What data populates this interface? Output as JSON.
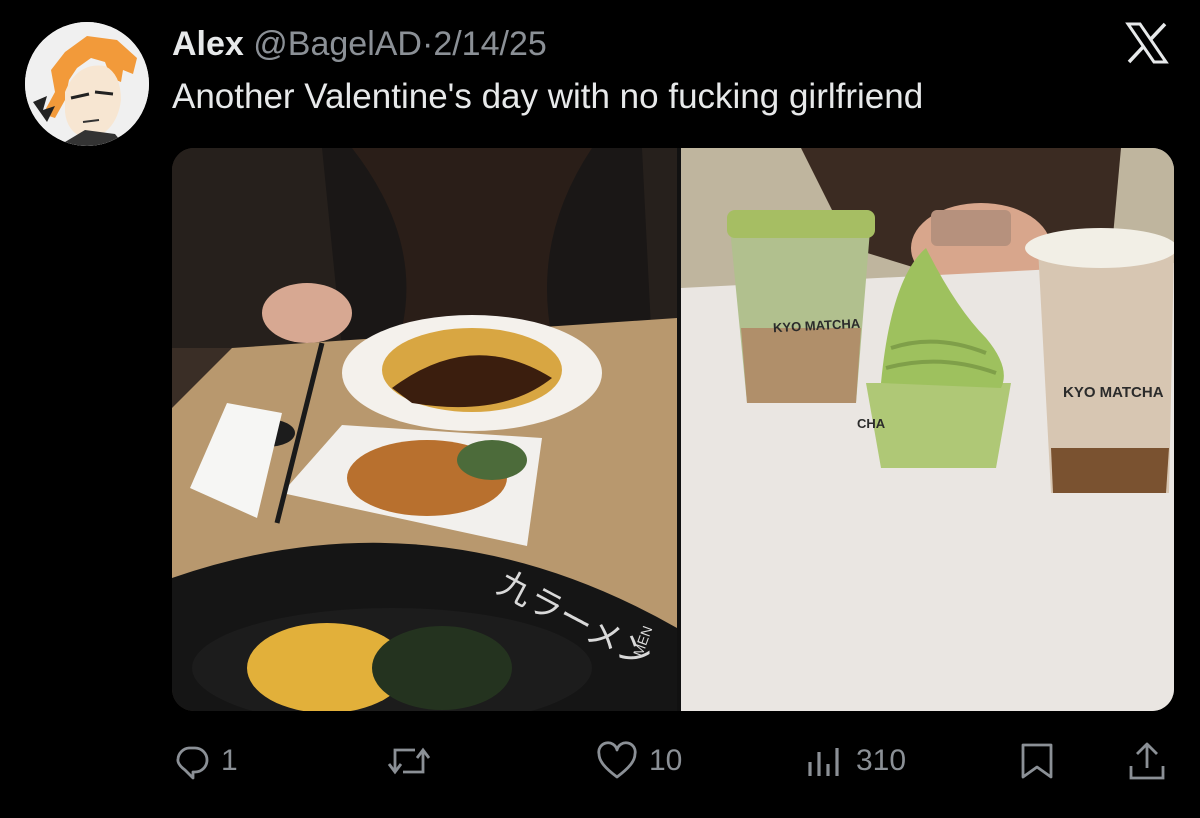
{
  "tweet": {
    "display_name": "Alex",
    "handle": "@BagelAD",
    "separator": "·",
    "date": "2/14/25",
    "text": "Another Valentine's day with no fucking girlfriend"
  },
  "media": {
    "left_photo": {
      "bowl_text": "九ラーメン",
      "side_text": "MEN"
    },
    "right_photo": {
      "cup_brand": "KYO MATCHA",
      "sundae_text": "CHA"
    }
  },
  "actions": {
    "reply": {
      "icon": "reply-icon",
      "count": "1"
    },
    "repost": {
      "icon": "repost-icon",
      "count": ""
    },
    "like": {
      "icon": "heart-icon",
      "count": "10"
    },
    "views": {
      "icon": "views-icon",
      "count": "310"
    },
    "bookmark": {
      "icon": "bookmark-icon"
    },
    "share": {
      "icon": "share-icon"
    }
  },
  "colors": {
    "background": "#000000",
    "text_primary": "#e7e9ea",
    "text_secondary": "#8b9096",
    "matcha_green": "#8fb865"
  }
}
